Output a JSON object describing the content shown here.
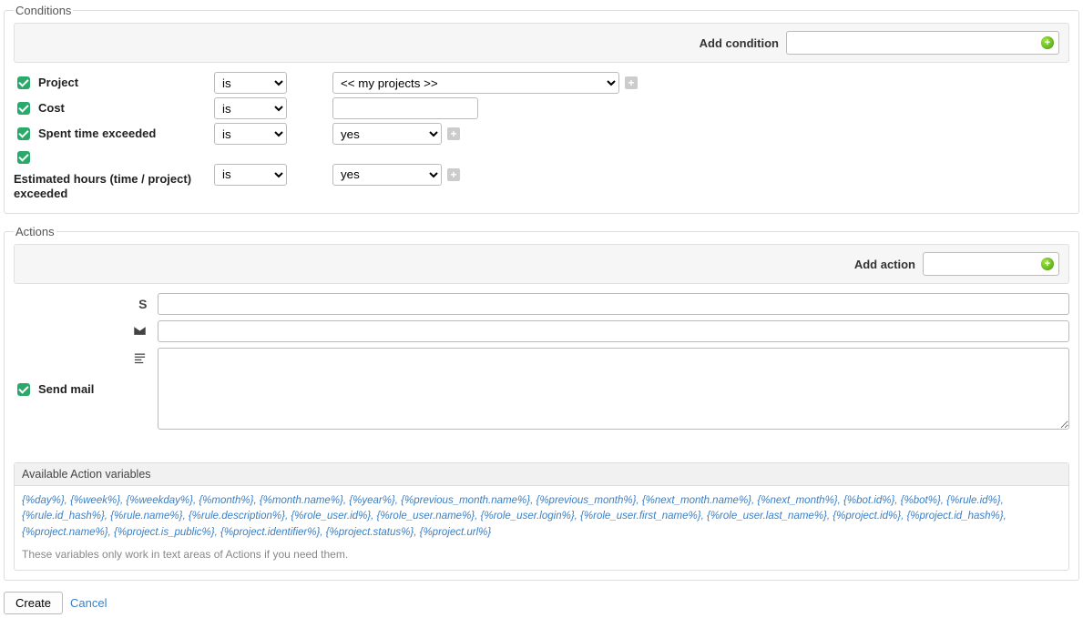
{
  "conditions": {
    "legend": "Conditions",
    "add_label": "Add condition",
    "items": [
      {
        "label": "Project",
        "op": "is",
        "value": "<< my projects >>",
        "type": "select",
        "extra": true
      },
      {
        "label": "Cost",
        "op": "is",
        "value": "",
        "type": "text",
        "extra": false
      },
      {
        "label": "Spent time exceeded",
        "op": "is",
        "value": "yes",
        "type": "yesno",
        "extra": true
      },
      {
        "label": "Estimated hours (time / project) exceeded",
        "op": "is",
        "value": "yes",
        "type": "yesno",
        "extra": true
      }
    ]
  },
  "actions": {
    "legend": "Actions",
    "add_label": "Add action",
    "send_mail_label": "Send mail",
    "subject_value": "",
    "recipients_value": "",
    "body_value": ""
  },
  "variables": {
    "title": "Available Action variables",
    "list": "{%day%}, {%week%}, {%weekday%}, {%month%}, {%month.name%}, {%year%}, {%previous_month.name%}, {%previous_month%}, {%next_month.name%}, {%next_month%}, {%bot.id%}, {%bot%}, {%rule.id%}, {%rule.id_hash%}, {%rule.name%}, {%rule.description%}, {%role_user.id%}, {%role_user.name%}, {%role_user.login%}, {%role_user.first_name%}, {%role_user.last_name%}, {%project.id%}, {%project.id_hash%}, {%project.name%}, {%project.is_public%}, {%project.identifier%}, {%project.status%}, {%project.url%}",
    "note": "These variables only work in text areas of Actions if you need them."
  },
  "buttons": {
    "create": "Create",
    "cancel": "Cancel"
  }
}
